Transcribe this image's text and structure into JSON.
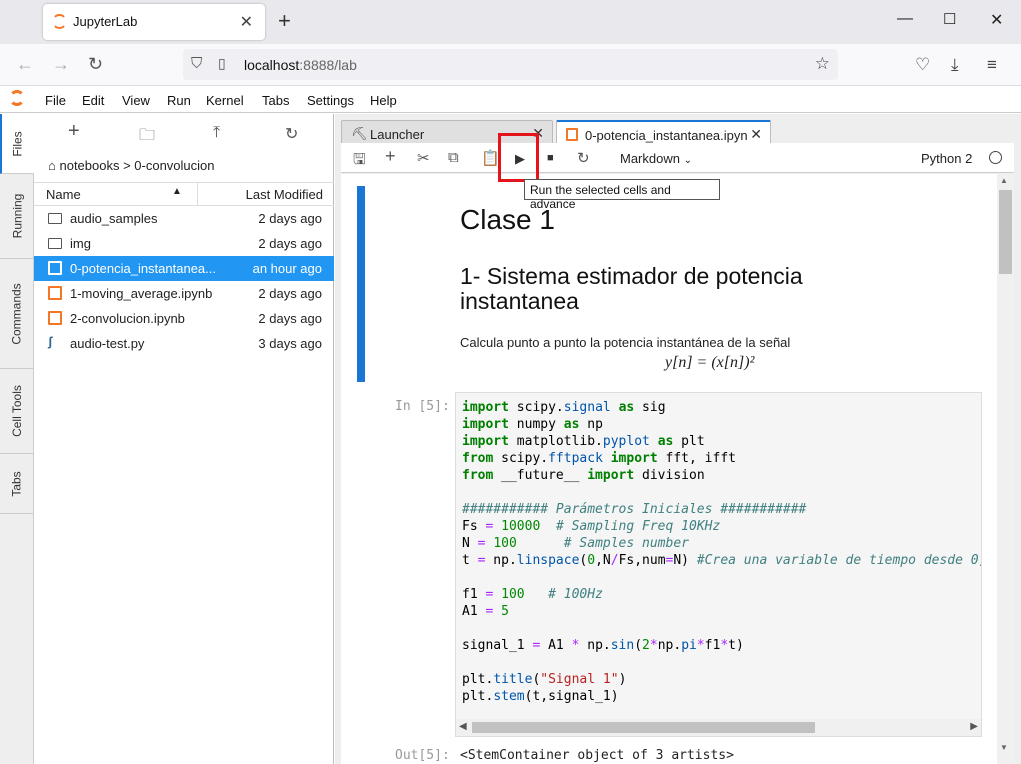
{
  "browser": {
    "tab_title": "JupyterLab",
    "close_glyph": "✕",
    "new_tab_glyph": "+",
    "url_host": "localhost",
    "url_rest": ":8888/lab",
    "window_controls": [
      "—",
      "☐",
      "✕"
    ]
  },
  "menu": [
    "File",
    "Edit",
    "View",
    "Run",
    "Kernel",
    "Tabs",
    "Settings",
    "Help"
  ],
  "rail_tabs": [
    "Files",
    "Running",
    "Commands",
    "Cell Tools",
    "Tabs"
  ],
  "filebrowser": {
    "breadcrumb": "notebooks > 0-convolucion",
    "col_name": "Name",
    "col_modified": "Last Modified",
    "files": [
      {
        "name": "audio_samples",
        "modified": "2 days ago",
        "type": "folder"
      },
      {
        "name": "img",
        "modified": "2 days ago",
        "type": "folder"
      },
      {
        "name": "0-potencia_instantanea...",
        "modified": "an hour ago",
        "type": "notebook",
        "selected": true
      },
      {
        "name": "1-moving_average.ipynb",
        "modified": "2 days ago",
        "type": "notebook"
      },
      {
        "name": "2-convolucion.ipynb",
        "modified": "2 days ago",
        "type": "notebook"
      },
      {
        "name": "audio-test.py",
        "modified": "3 days ago",
        "type": "python"
      }
    ]
  },
  "doc_tabs": [
    {
      "label": "Launcher"
    },
    {
      "label": "0-potencia_instantanea.ipyn"
    }
  ],
  "toolbar": {
    "cell_type": "Markdown",
    "kernel": "Python 2",
    "tooltip": "Run the selected cells and advance"
  },
  "notebook": {
    "h1": "Clase 1",
    "h2": "1- Sistema estimador de potencia instantanea",
    "paragraph": "Calcula punto a punto la potencia instantánea de la señal",
    "math": "y[n] = (x[n])²",
    "in_prompt": "In [5]:",
    "out_prompt": "Out[5]:",
    "output": "<StemContainer object of 3 artists>"
  },
  "colors": {
    "accent": "#1976d2",
    "jupyter_orange": "#f37726",
    "highlight_red": "#e4141b"
  }
}
